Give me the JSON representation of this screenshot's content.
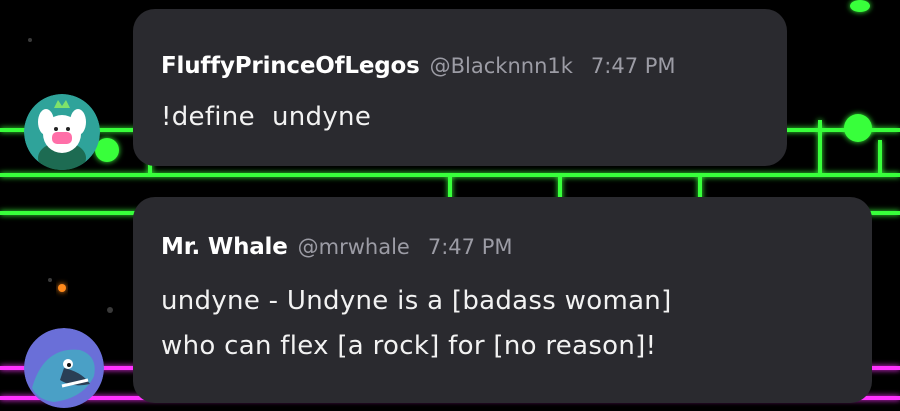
{
  "messages": [
    {
      "username": "FluffyPrinceOfLegos",
      "handle": "@Blacknnn1k",
      "time": "7:47 PM",
      "text": "!define  undyne",
      "avatar_icon": "pink-rabbit-avatar"
    },
    {
      "username": "Mr. Whale",
      "handle": "@mrwhale",
      "time": "7:47 PM",
      "text_line1": "undyne - Undyne is a [badass woman]",
      "text_line2": "who can flex [a rock] for [no reason]!",
      "avatar_icon": "blue-fish-avatar"
    }
  ],
  "colors": {
    "background": "#000000",
    "bubble": "#2a2a2f",
    "staff_green": "#39ff3a",
    "staff_magenta": "#ff33ff",
    "username": "#ffffff",
    "meta": "#9c9ca5"
  }
}
